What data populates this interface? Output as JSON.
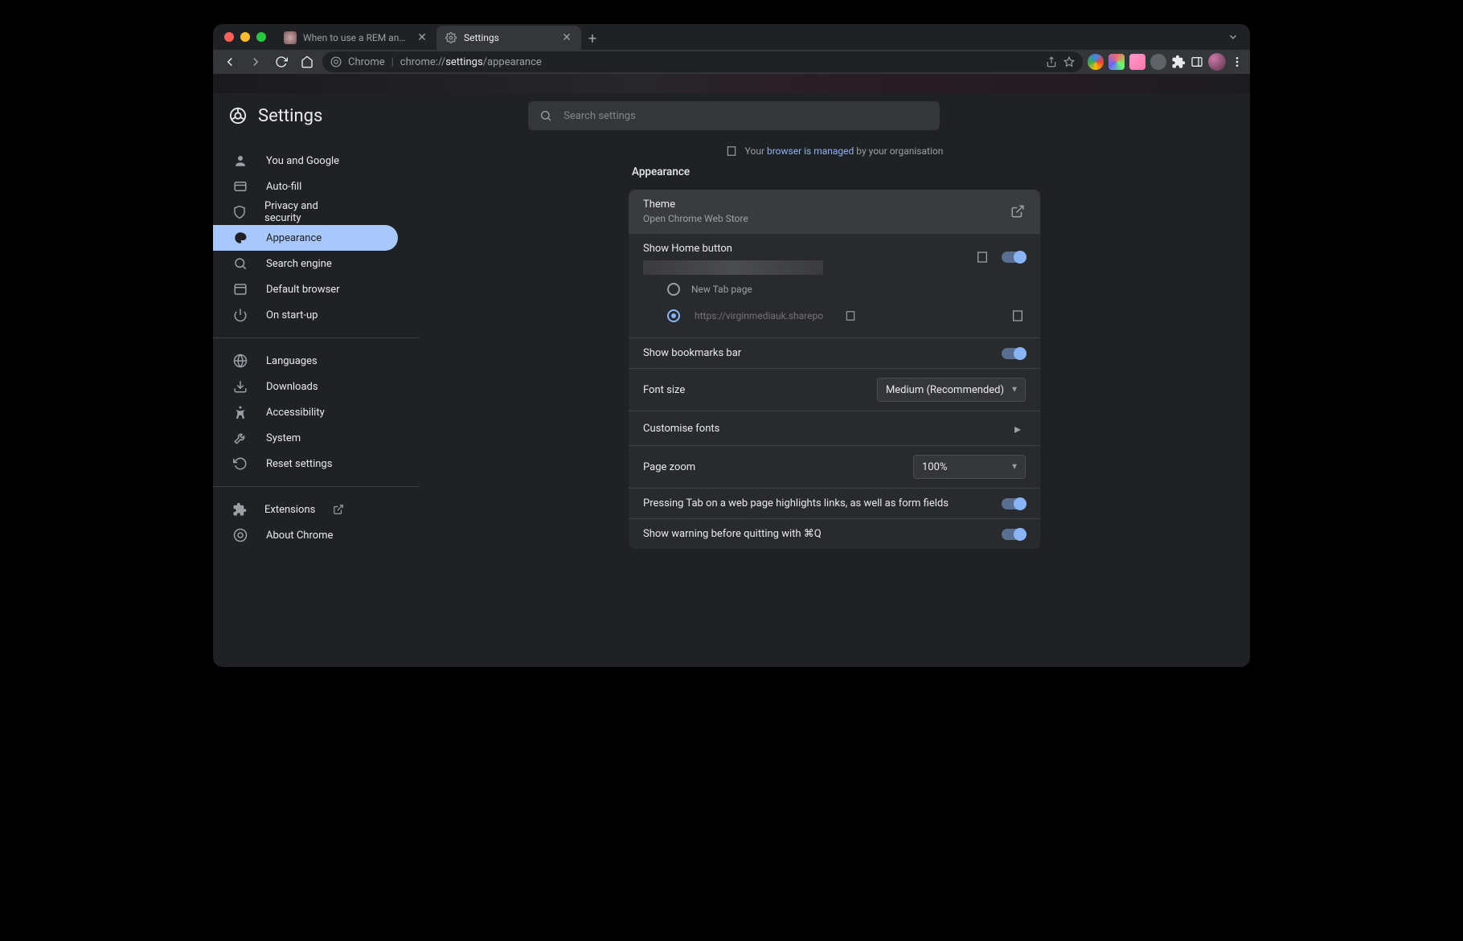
{
  "tabs": [
    {
      "title": "When to use a REM and when t",
      "active": false
    },
    {
      "title": "Settings",
      "active": true
    }
  ],
  "omnibox": {
    "scheme_label": "Chrome",
    "prefix": "chrome://",
    "path_bold": "settings",
    "path_rest": "/appearance"
  },
  "header": {
    "title": "Settings",
    "search_placeholder": "Search settings"
  },
  "managed": {
    "prefix": "Your ",
    "link": "browser is managed",
    "suffix": " by your organisation"
  },
  "sidebar": {
    "group1": [
      {
        "key": "you",
        "label": "You and Google",
        "icon": "person"
      },
      {
        "key": "autofill",
        "label": "Auto-fill",
        "icon": "autofill"
      },
      {
        "key": "privacy",
        "label": "Privacy and security",
        "icon": "shield"
      },
      {
        "key": "appearance",
        "label": "Appearance",
        "icon": "palette",
        "active": true
      },
      {
        "key": "search",
        "label": "Search engine",
        "icon": "search"
      },
      {
        "key": "default",
        "label": "Default browser",
        "icon": "browser"
      },
      {
        "key": "startup",
        "label": "On start-up",
        "icon": "power"
      }
    ],
    "group2": [
      {
        "key": "languages",
        "label": "Languages",
        "icon": "globe"
      },
      {
        "key": "downloads",
        "label": "Downloads",
        "icon": "download"
      },
      {
        "key": "accessibility",
        "label": "Accessibility",
        "icon": "a11y"
      },
      {
        "key": "system",
        "label": "System",
        "icon": "wrench"
      },
      {
        "key": "reset",
        "label": "Reset settings",
        "icon": "reset"
      }
    ],
    "group3": [
      {
        "key": "extensions",
        "label": "Extensions",
        "icon": "puzzle",
        "external": true
      },
      {
        "key": "about",
        "label": "About Chrome",
        "icon": "chrome"
      }
    ]
  },
  "section": {
    "title": "Appearance",
    "theme": {
      "label": "Theme",
      "sub": "Open Chrome Web Store"
    },
    "home": {
      "label": "Show Home button",
      "on": true,
      "radio_new_tab": "New Tab page",
      "custom_url": "https://virginmediauk.sharepoint.com/"
    },
    "bookmarks": {
      "label": "Show bookmarks bar",
      "on": true
    },
    "fontsize": {
      "label": "Font size",
      "value": "Medium (Recommended)"
    },
    "custom_fonts": {
      "label": "Customise fonts"
    },
    "zoom": {
      "label": "Page zoom",
      "value": "100%"
    },
    "tab_highlight": {
      "label": "Pressing Tab on a web page highlights links, as well as form fields",
      "on": true
    },
    "quit_warn": {
      "label": "Show warning before quitting with ⌘Q",
      "on": true
    }
  }
}
